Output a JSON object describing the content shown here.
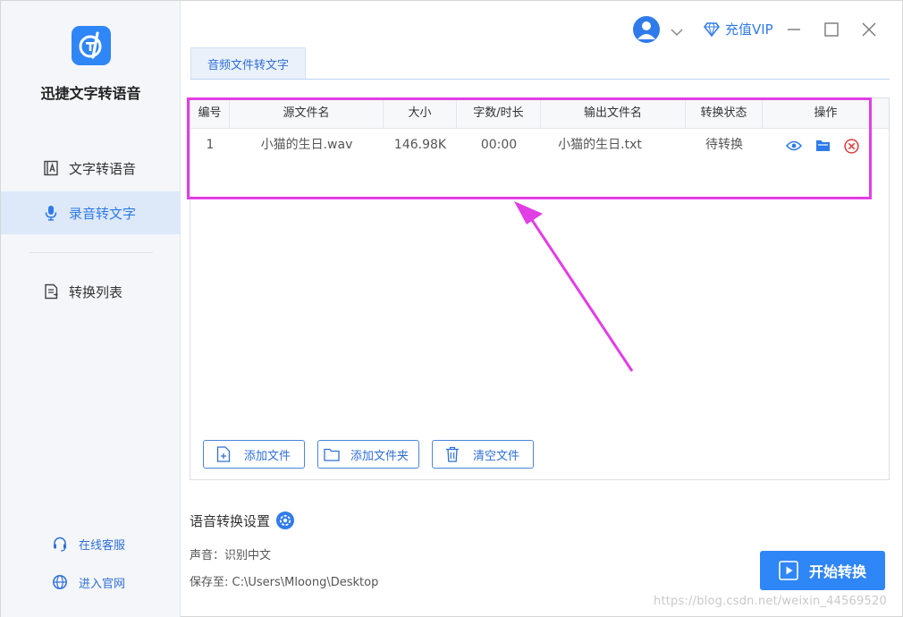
{
  "app": {
    "name": "迅捷文字转语音",
    "brand_color": "#2f86f6"
  },
  "sidebar": {
    "items": [
      {
        "label": "文字转语音",
        "icon": "text-doc-icon",
        "active": false
      },
      {
        "label": "录音转文字",
        "icon": "microphone-icon",
        "active": true
      },
      {
        "label": "转换列表",
        "icon": "list-doc-icon",
        "active": false
      }
    ],
    "footer": [
      {
        "label": "在线客服",
        "icon": "headset-icon"
      },
      {
        "label": "进入官网",
        "icon": "globe-icon"
      }
    ]
  },
  "titlebar": {
    "vip_label": "充值VIP",
    "icons": [
      "user-avatar-icon",
      "chevron-down-icon",
      "diamond-icon",
      "minimize-icon",
      "maximize-icon",
      "close-icon"
    ]
  },
  "tab": {
    "label": "音频文件转文字"
  },
  "table": {
    "headers": [
      "编号",
      "源文件名",
      "大小",
      "字数/时长",
      "输出文件名",
      "转换状态",
      "操作"
    ],
    "rows": [
      {
        "index": "1",
        "source": "小猫的生日.wav",
        "size": "146.98K",
        "duration": "00:00",
        "output": "小猫的生日.txt",
        "status": "待转换",
        "actions": [
          "eye-icon",
          "folder-icon",
          "delete-circle-icon"
        ]
      }
    ]
  },
  "buttons": {
    "add_file": "添加文件",
    "add_folder": "添加文件夹",
    "clear_files": "清空文件"
  },
  "settings": {
    "title": "语音转换设置",
    "voice": "声音：识别中文",
    "save_to": "保存至: C:\\Users\\Mloong\\Desktop"
  },
  "start_button": "开始转换",
  "watermark": "https://blog.csdn.net/weixin_44569520",
  "annotation_color": "#e23ee5"
}
